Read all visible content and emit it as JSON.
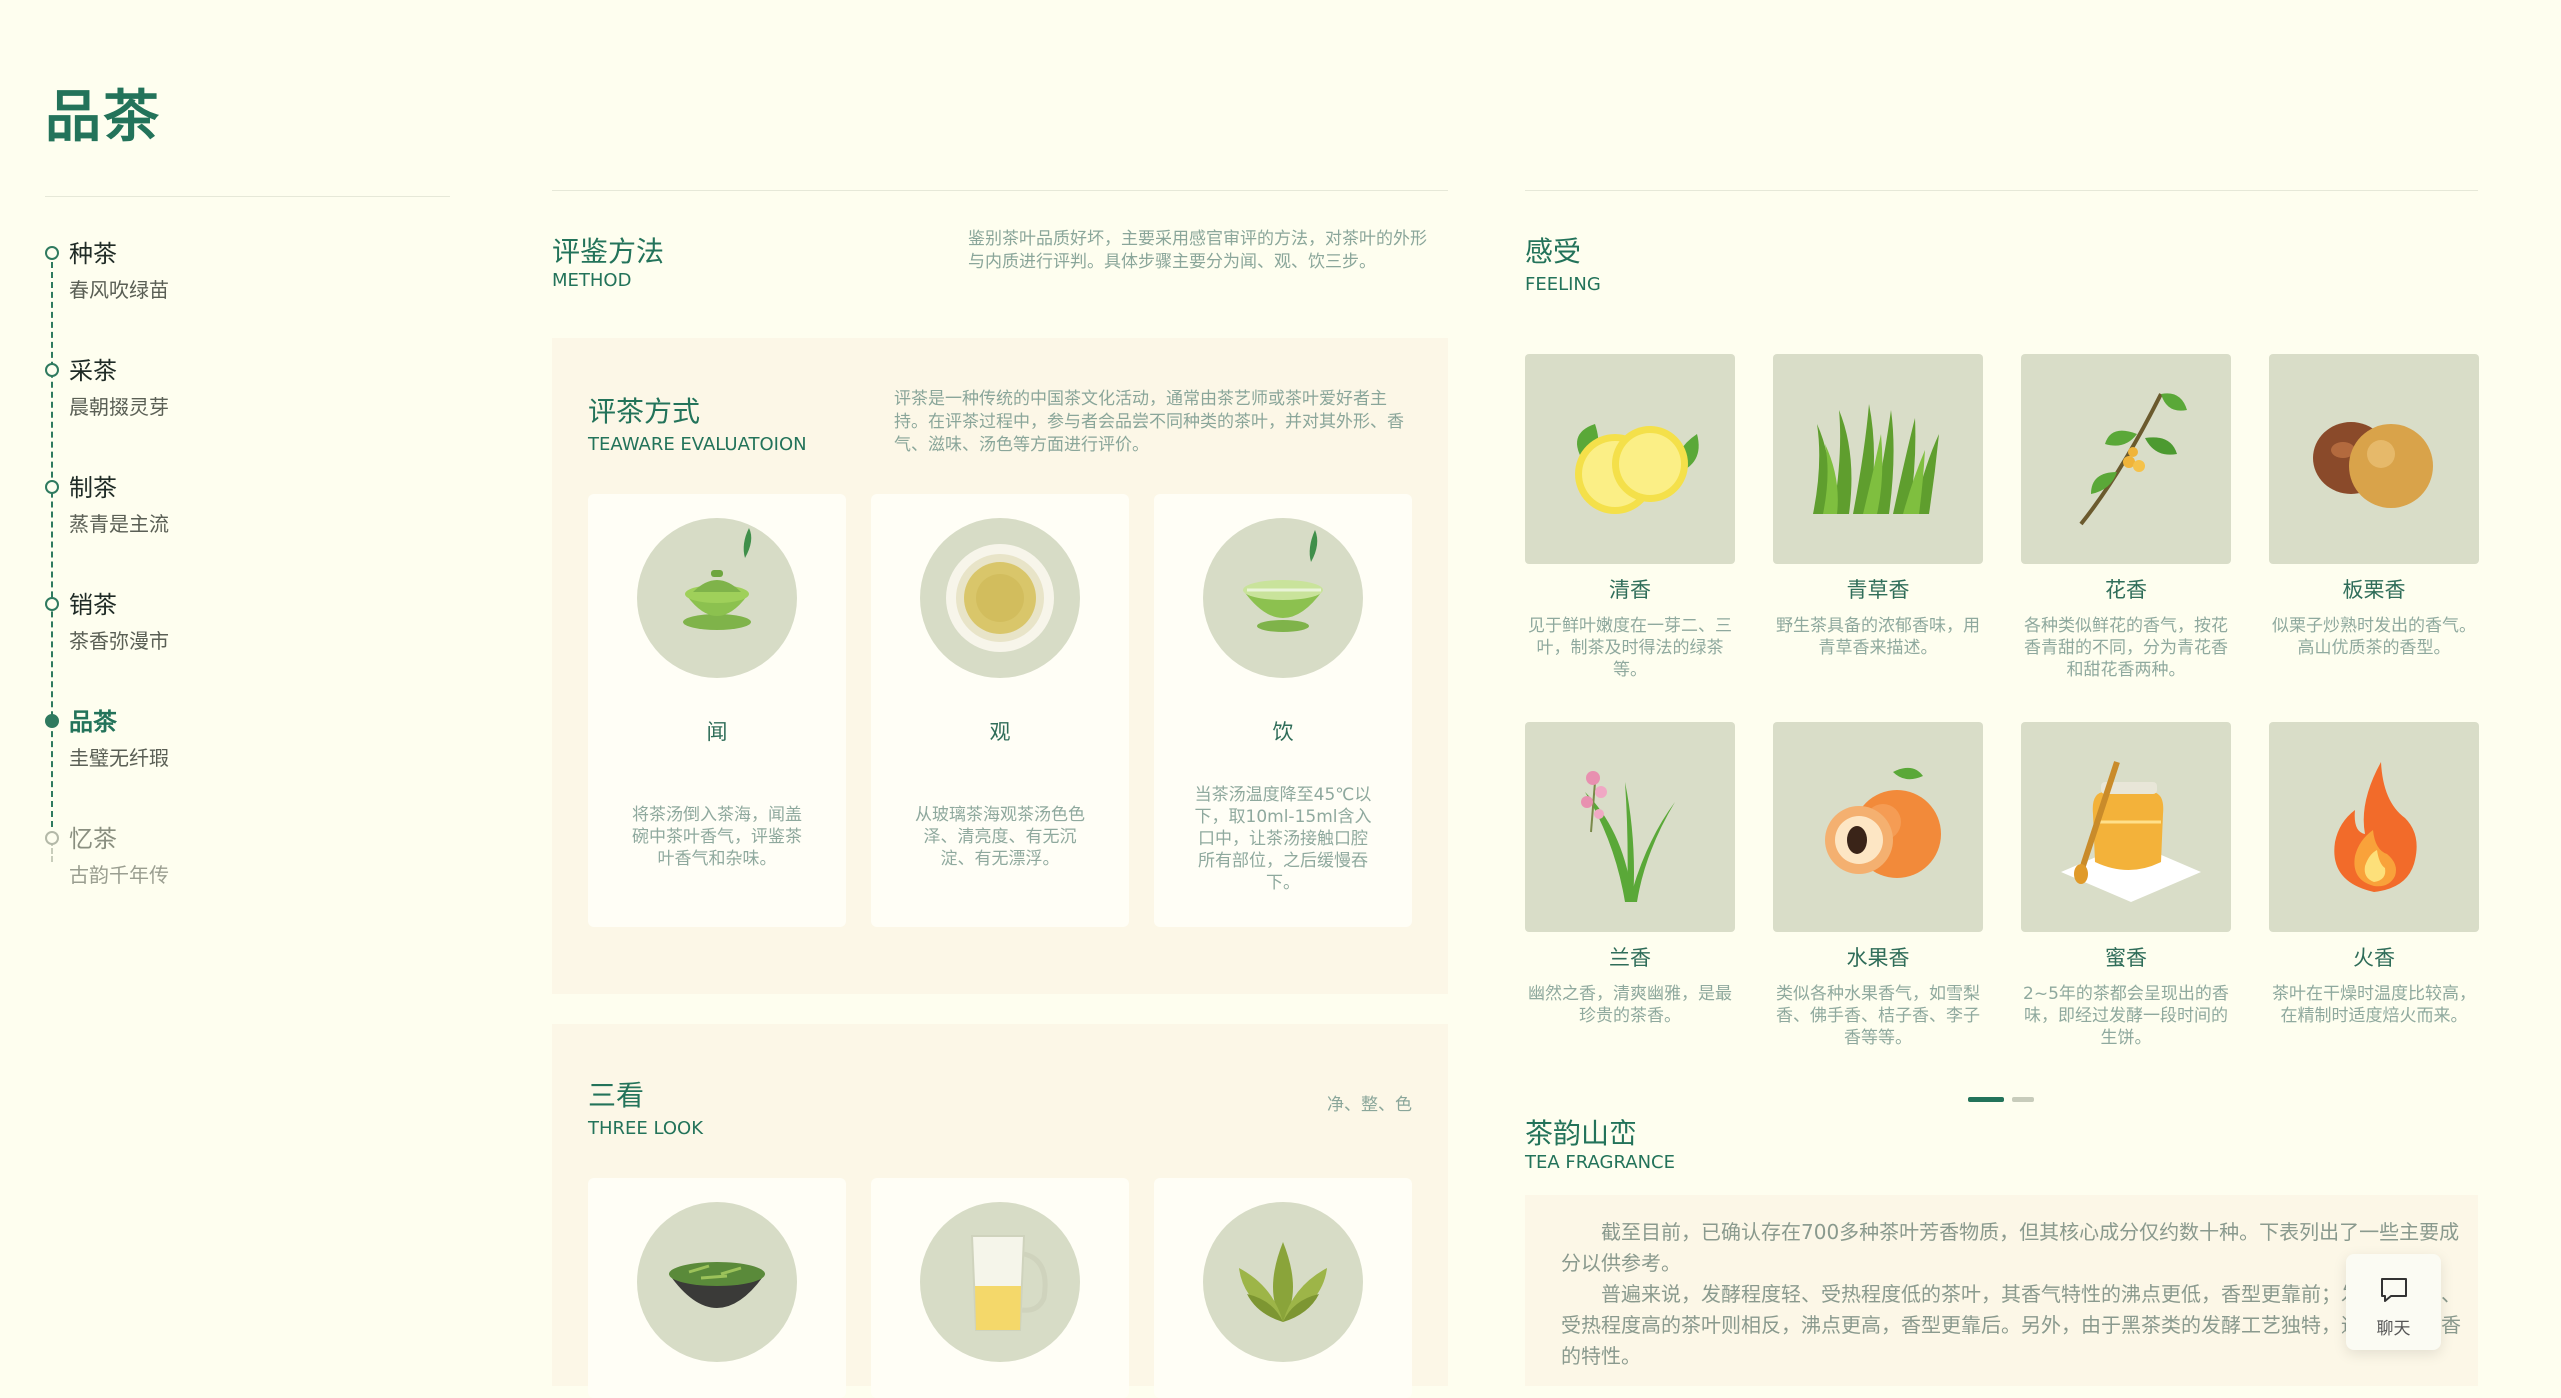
{
  "page": {
    "title": "品茶"
  },
  "nav": {
    "items": [
      {
        "title": "种茶",
        "subtitle": "春风吹绿苗",
        "state": "normal"
      },
      {
        "title": "采茶",
        "subtitle": "晨朝掇灵芽",
        "state": "normal"
      },
      {
        "title": "制茶",
        "subtitle": "蒸青是主流",
        "state": "normal"
      },
      {
        "title": "销茶",
        "subtitle": "茶香弥漫市",
        "state": "normal"
      },
      {
        "title": "品茶",
        "subtitle": "圭璧无纤瑕",
        "state": "active"
      },
      {
        "title": "忆茶",
        "subtitle": "古韵千年传",
        "state": "faded"
      }
    ]
  },
  "method": {
    "title": "评鉴方法",
    "en": "METHOD",
    "desc": "鉴别茶叶品质好坏，主要采用感官审评的方法，对茶叶的外形与内质进行评判。具体步骤主要分为闻、观、饮三步。"
  },
  "evaluation": {
    "title": "评茶方式",
    "en": "TEAWARE EVALUATOION",
    "desc": "评茶是一种传统的中国茶文化活动，通常由茶艺师或茶叶爱好者主持。在评茶过程中，参与者会品尝不同种类的茶叶，并对其外形、香气、滋味、汤色等方面进行评价。",
    "cards": [
      {
        "title": "闻",
        "icon": "gaiwan-icon",
        "desc": "将茶汤倒入茶海，闻盖碗中茶叶香气，评鉴茶叶香气和杂味。"
      },
      {
        "title": "观",
        "icon": "tea-cup-top-icon",
        "desc": "从玻璃茶海观茶汤色色泽、清亮度、有无沉淀、有无漂浮。"
      },
      {
        "title": "饮",
        "icon": "tea-bowl-icon",
        "desc": "当茶汤温度降至45℃以下，取10ml-15ml含入口中，让茶汤接触口腔所有部位，之后缓慢吞下。"
      }
    ]
  },
  "three_look": {
    "title": "三看",
    "en": "THREE LOOK",
    "tag": "净、整、色",
    "cards": [
      {
        "icon": "tea-leaf-bowl-icon"
      },
      {
        "icon": "glass-pitcher-icon"
      },
      {
        "icon": "tea-leaves-icon"
      }
    ]
  },
  "feeling": {
    "title": "感受",
    "en": "FEELING",
    "items": [
      {
        "name": "清香",
        "icon": "lemon-icon",
        "desc": "见于鲜叶嫩度在一芽二、三叶，制茶及时得法的绿茶等。"
      },
      {
        "name": "青草香",
        "icon": "grass-icon",
        "desc": "野生茶具备的浓郁香味，用青草香来描述。"
      },
      {
        "name": "花香",
        "icon": "flower-branch-icon",
        "desc": "各种类似鲜花的香气，按花香青甜的不同，分为青花香和甜花香两种。"
      },
      {
        "name": "板栗香",
        "icon": "chestnut-icon",
        "desc": "似栗子炒熟时发出的香气。高山优质茶的香型。"
      },
      {
        "name": "兰香",
        "icon": "orchid-icon",
        "desc": "幽然之香，清爽幽雅，是最珍贵的茶香。"
      },
      {
        "name": "水果香",
        "icon": "peach-icon",
        "desc": "类似各种水果香气，如雪梨香、佛手香、桔子香、李子香等等。"
      },
      {
        "name": "蜜香",
        "icon": "honey-jar-icon",
        "desc": "2~5年的茶都会呈现出的香味，即经过发酵一段时间的生饼。"
      },
      {
        "name": "火香",
        "icon": "flame-icon",
        "desc": "茶叶在干燥时温度比较高，在精制时适度焙火而来。"
      }
    ]
  },
  "fragrance": {
    "title": "茶韵山峦",
    "en": "TEA FRAGRANCE",
    "paragraphs": [
      "截至目前，已确认存在700多种茶叶芳香物质，但其核心成分仅约数十种。下表列出了一些主要成分以供参考。",
      "普遍来说，发酵程度轻、受热程度低的茶叶，其香气特性的沸点更低，香型更靠前；发酵程度高、受热程度高的茶叶则相反，沸点更高，香型更靠后。另外，由于黑茶类的发酵工艺独特，通常带有陈香的特性。"
    ]
  },
  "chat": {
    "label": "聊天"
  },
  "colors": {
    "accent": "#23735a",
    "background": "#fefeef",
    "panel": "#fcf7e7",
    "tile": "#d9ddc8"
  }
}
